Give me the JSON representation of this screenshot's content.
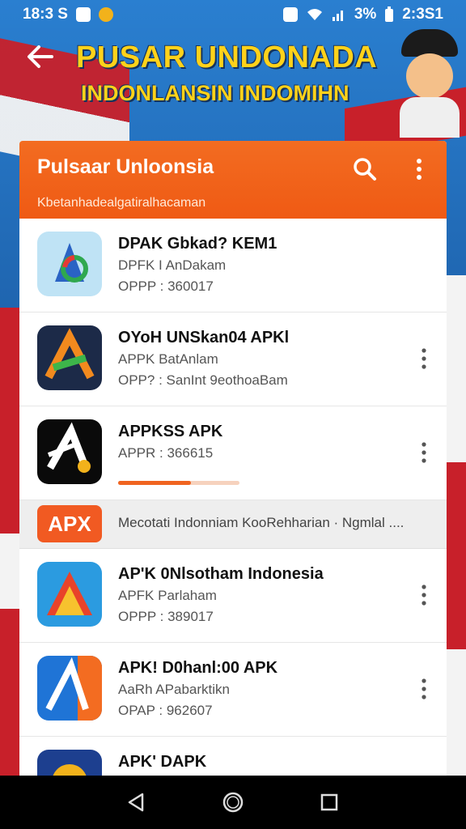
{
  "status_bar": {
    "time_left": "18:3 S",
    "battery": "3%",
    "time_right": "2:3S1"
  },
  "banner": {
    "title": "PUSAR UNDONADA",
    "subtitle": "INDONLANSIN INDOMIHN"
  },
  "appbar": {
    "title": "Pulsaar Unloonsia",
    "subtitle": "Kbetanhadealgatiralhacaman",
    "color": "#f06420"
  },
  "apps": [
    {
      "name": "DPAK Gbkad? KEM1",
      "line2": "DPFK I AnDakam",
      "line3": "OPPP : 360017",
      "has_menu": false
    },
    {
      "name": "OYoH UNSkan04 APKl",
      "line2": "APPK BatAnlam",
      "line3": "OPP? : SanInt 9eothoaBam",
      "has_menu": true
    },
    {
      "name": "APPKSS APK",
      "line2": "APPR : 366615",
      "line3": "",
      "has_menu": true,
      "download_progress": 0.6
    },
    {
      "name": "AP'K 0Nlsotham Indonesia",
      "line2": "APFK Parlaham",
      "line3": "OPPP : 389017",
      "has_menu": true
    },
    {
      "name": "APK! D0hanl:00 APK",
      "line2": "AaRh APabarktikn",
      "line3": "OPAP : 962607",
      "has_menu": true
    },
    {
      "name": "APK' DAPK",
      "line2": "",
      "line3": "",
      "has_menu": false
    }
  ],
  "promo": {
    "badge": "APX",
    "text": "Mecotati Indonniam KooRehharian  ·  Ngmlal ...."
  },
  "icons": [
    "back-arrow-icon",
    "search-icon",
    "more-vert-icon",
    "nav-back-icon",
    "nav-home-icon",
    "nav-recents-icon"
  ]
}
